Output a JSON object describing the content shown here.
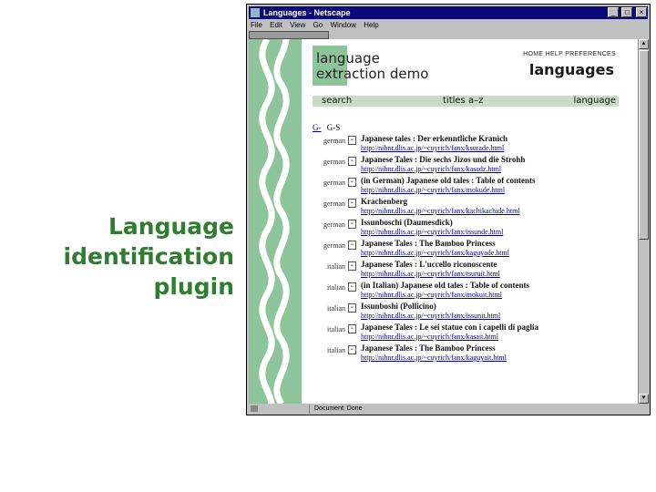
{
  "slide": {
    "title": [
      "Language",
      "identification",
      "plugin"
    ]
  },
  "window": {
    "title": "Languages - Netscape",
    "controls": {
      "minimize": "_",
      "maximize": "□",
      "close": "×"
    },
    "menu": [
      "File",
      "Edit",
      "View",
      "Go",
      "Window",
      "Help"
    ]
  },
  "header": {
    "title_line1": "language",
    "title_line2": "extraction demo",
    "nav": "HOME  HELP  PREFERENCES",
    "current": "languages",
    "bar": {
      "search": "search",
      "titles": "titles a–z",
      "language": "language"
    }
  },
  "listing": {
    "prev_link": "G-",
    "range": "G-S",
    "rows": [
      {
        "lang": "german",
        "title": "Japanese tales : Der erkenntliche Kranich",
        "url": "http://nihnr.dlis.ac.jp/~cuyrich/fanx/ksurade.html"
      },
      {
        "lang": "german",
        "title": "Japanese Tales : Die sechs Jizos und die Strohh",
        "url": "http://nihnr.dlis.ac.jp/~cuyrich/fanx/kasadz.html"
      },
      {
        "lang": "german",
        "title": "(in German) Japanese old tales : Table of contents",
        "url": "http://nihnr.dlis.ac.jp/~cuyrich/fanx/mokude.html"
      },
      {
        "lang": "german",
        "title": "Krachenberg",
        "url": "http://nihnr.dlis.ac.jp/~cuyrich/fanx/kachikachide.html"
      },
      {
        "lang": "german",
        "title": "Issunboschi (Daumesdick)",
        "url": "http://nihnr.dlis.ac.jp/~cuyrich/fanx/issunde.html"
      },
      {
        "lang": "german",
        "title": "Japanese Tales : The Bamboo Princess",
        "url": "http://nihnr.dlis.ac.jp/~cuyrich/fanx/kaguyade.html"
      },
      {
        "lang": "italian",
        "title": "Japanese Tales : L'uccello riconoscente",
        "url": "http://nihnr.dlis.ac.jp/~cuyrich/fanx/tsuruit.html"
      },
      {
        "lang": "italian",
        "title": "(in Italian) Japanese old tales : Table of contents",
        "url": "http://nihnr.dlis.ac.jp/~cuyrich/fanx/mokuit.html"
      },
      {
        "lang": "italian",
        "title": "Issunboshi (Pollicino)",
        "url": "http://nihnr.dlis.ac.jp/~cuyrich/fanx/issunit.html"
      },
      {
        "lang": "italian",
        "title": "Japanese Tales : Le sei statue con i capelli di paglia",
        "url": "http://nihnr.dlis.ac.jp/~cuyrich/fanx/kasait.html"
      },
      {
        "lang": "italian",
        "title": "Japanese Tales : The Bamboo Princess",
        "url": "http://nihnr.dlis.ac.jp/~cuyrich/fanx/kaguyait.html"
      }
    ]
  },
  "status": {
    "text": "Document: Done"
  },
  "colors": {
    "accent_green": "#2f7d2f",
    "band_green": "#8ec49a",
    "titlebar_blue": "#0a0a7a",
    "link_blue": "#00008b"
  }
}
